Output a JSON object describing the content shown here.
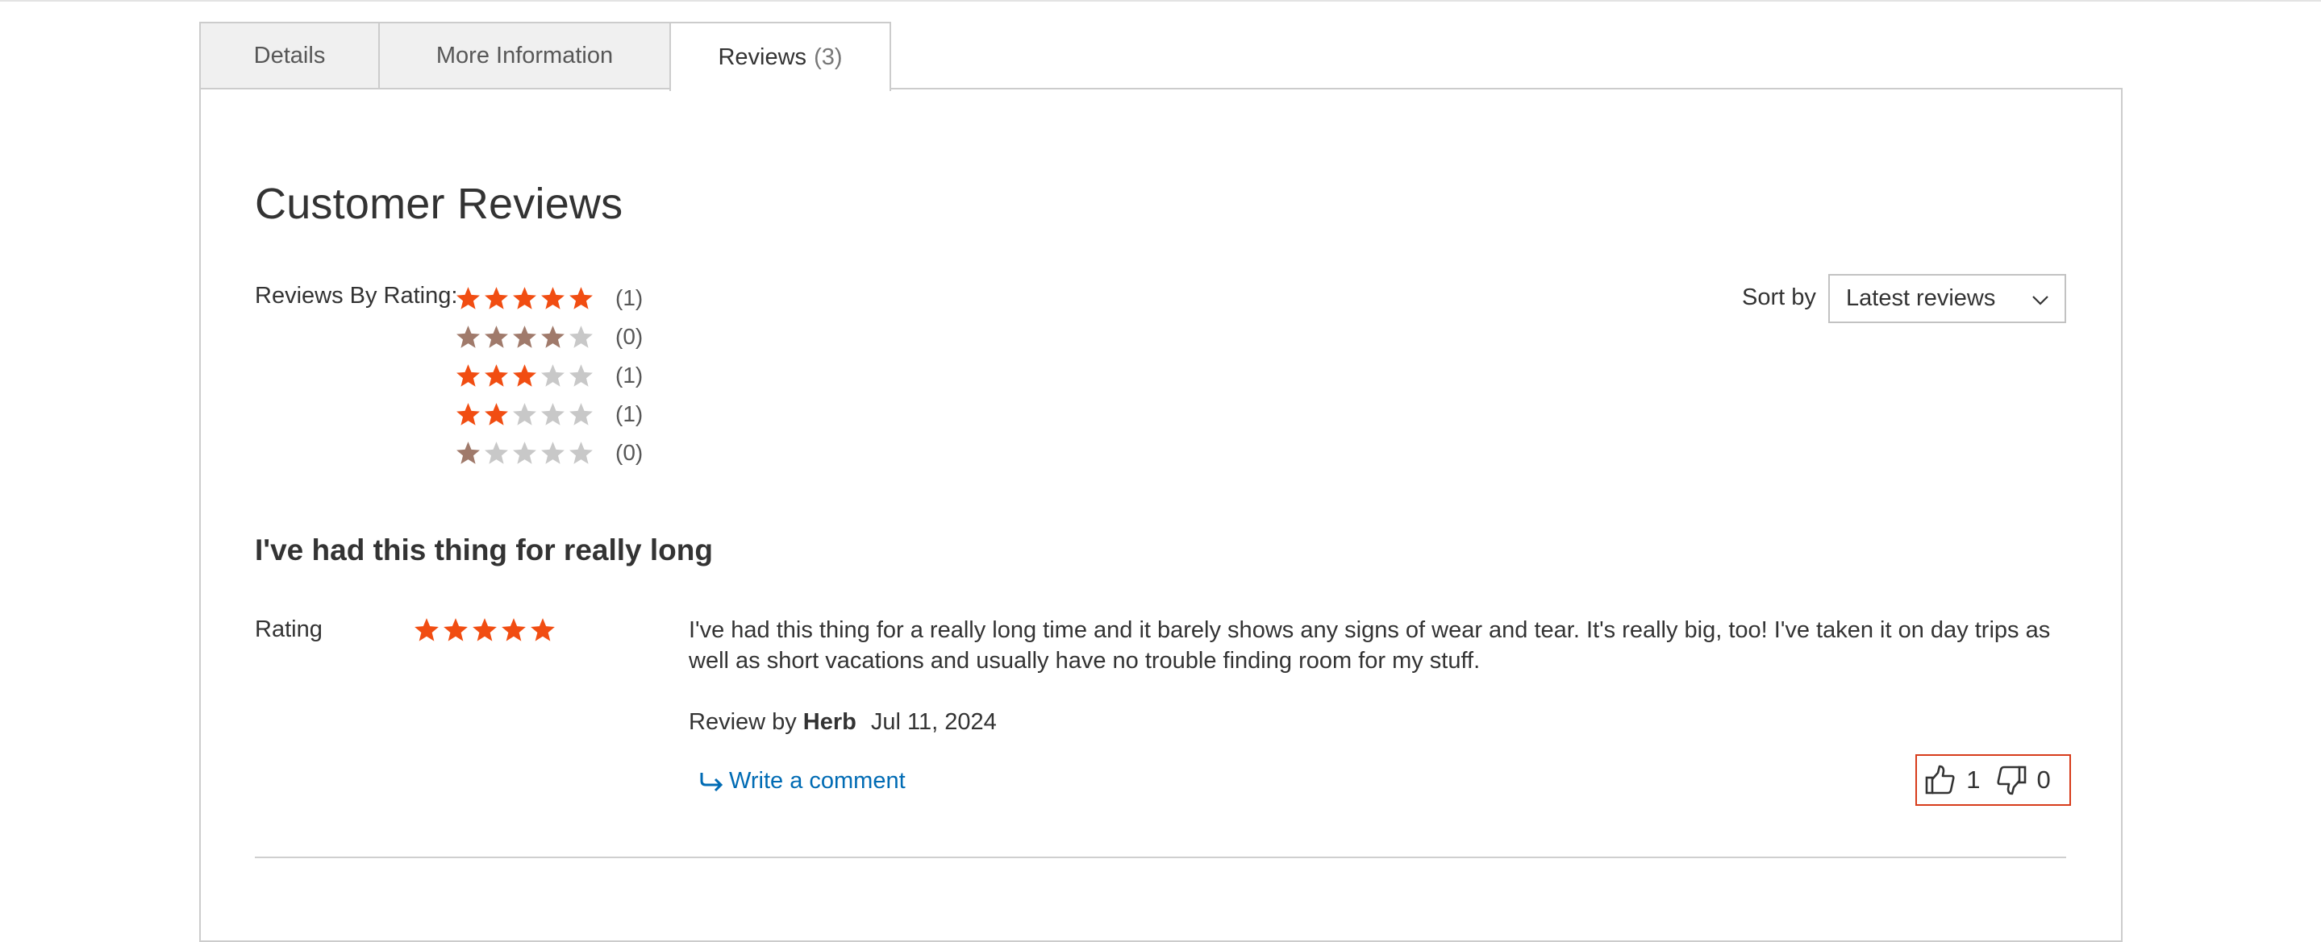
{
  "tabs": [
    {
      "label": "Details"
    },
    {
      "label": "More Information"
    },
    {
      "label": "Reviews",
      "count": "(3)",
      "active": true
    }
  ],
  "reviews_section": {
    "heading": "Customer Reviews",
    "by_rating_label": "Reviews By Rating:",
    "rating_summary": [
      {
        "stars": 5,
        "count": "(1)"
      },
      {
        "stars": 4,
        "count": "(0)"
      },
      {
        "stars": 3,
        "count": "(1)"
      },
      {
        "stars": 2,
        "count": "(1)"
      },
      {
        "stars": 1,
        "count": "(0)"
      }
    ],
    "sort": {
      "label": "Sort by",
      "selected": "Latest reviews"
    }
  },
  "review": {
    "title": "I've had this thing for really long",
    "rating_label": "Rating",
    "rating": 5,
    "text": "I've had this thing for a really long time and it barely shows any signs of wear and tear. It's really big, too! I've taken it on day trips as well as short vacations and usually have no trouble finding room for my stuff.",
    "by_label": "Review by",
    "author": "Herb",
    "date": "Jul 11, 2024",
    "write_comment": "Write a comment",
    "helpful_count": "1",
    "unhelpful_count": "0"
  },
  "colors": {
    "star_active": "#f14d12",
    "star_active_muted": "#a07a6b",
    "star_empty": "#c8c8c8",
    "link": "#006bb4",
    "vote_border": "#d73c1b"
  },
  "icons": {
    "star": "star-icon",
    "comment": "reply-arrow-icon",
    "helpful": "thumbs-up-icon",
    "unhelpful": "thumbs-down-icon",
    "sort": "chevron-down-icon"
  }
}
